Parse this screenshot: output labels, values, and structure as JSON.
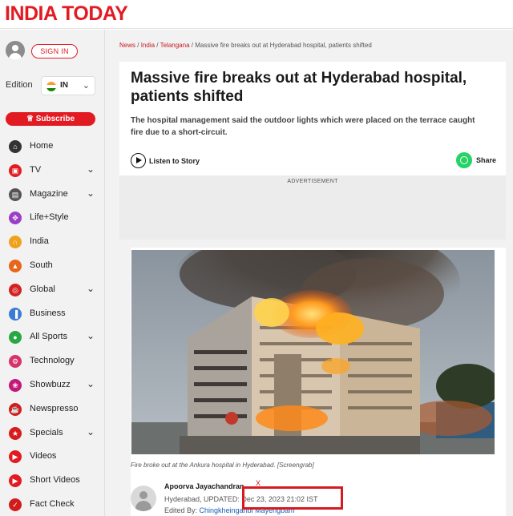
{
  "header": {
    "logo": "INDIA TODAY",
    "brand_color": "#e21b22"
  },
  "sidebar": {
    "sign_in": "SIGN IN",
    "edition_label": "Edition",
    "edition_value": "IN",
    "subscribe": "Subscribe",
    "items": [
      {
        "label": "Home",
        "icon": "home-icon",
        "color": "#333333",
        "chevron": false
      },
      {
        "label": "TV",
        "icon": "live-tv-icon",
        "color": "#e21b22",
        "chevron": true
      },
      {
        "label": "Magazine",
        "icon": "magazine-icon",
        "color": "#555555",
        "chevron": true
      },
      {
        "label": "Life+Style",
        "icon": "cocktail-icon",
        "color": "#9b3fc7",
        "chevron": false
      },
      {
        "label": "India",
        "icon": "india-gate-icon",
        "color": "#f0a11c",
        "chevron": false
      },
      {
        "label": "South",
        "icon": "temple-icon",
        "color": "#e8651a",
        "chevron": false
      },
      {
        "label": "Global",
        "icon": "globe-icon",
        "color": "#d32020",
        "chevron": true
      },
      {
        "label": "Business",
        "icon": "bar-chart-icon",
        "color": "#3a7bd5",
        "chevron": false
      },
      {
        "label": "All Sports",
        "icon": "sports-icon",
        "color": "#27a844",
        "chevron": true
      },
      {
        "label": "Technology",
        "icon": "tech-icon",
        "color": "#d6336c",
        "chevron": false
      },
      {
        "label": "Showbuzz",
        "icon": "showbuzz-icon",
        "color": "#c2187a",
        "chevron": true
      },
      {
        "label": "Newspresso",
        "icon": "coffee-icon",
        "color": "#d21c1c",
        "chevron": false
      },
      {
        "label": "Specials",
        "icon": "specials-icon",
        "color": "#d81b1b",
        "chevron": true
      },
      {
        "label": "Videos",
        "icon": "video-icon",
        "color": "#e21b22",
        "chevron": false
      },
      {
        "label": "Short Videos",
        "icon": "short-video-icon",
        "color": "#e21b22",
        "chevron": false
      },
      {
        "label": "Fact Check",
        "icon": "fact-check-icon",
        "color": "#d21c1c",
        "chevron": false
      }
    ]
  },
  "breadcrumb": {
    "news": "News",
    "india": "India",
    "telangana": "Telangana",
    "current": "Massive fire breaks out at Hyderabad hospital, patients shifted"
  },
  "article": {
    "headline": "Massive fire breaks out at Hyderabad hospital, patients shifted",
    "summary": "The hospital management said the outdoor lights which were placed on the terrace caught fire due to a short-circuit.",
    "listen": "Listen to Story",
    "share": "Share",
    "advertisement": "ADVERTISEMENT",
    "caption": "Fire broke out at the Ankura hospital in Hyderabad. [Screengrab]",
    "author": "Apoorva Jayachandran",
    "author_social": "X",
    "location": "Hyderabad,",
    "updated_label": "UPDATED:",
    "updated": "Dec 23, 2023 21:02 IST",
    "edited_label": "Edited By:",
    "editor": "Chingkheinganbi Mayengbam"
  }
}
